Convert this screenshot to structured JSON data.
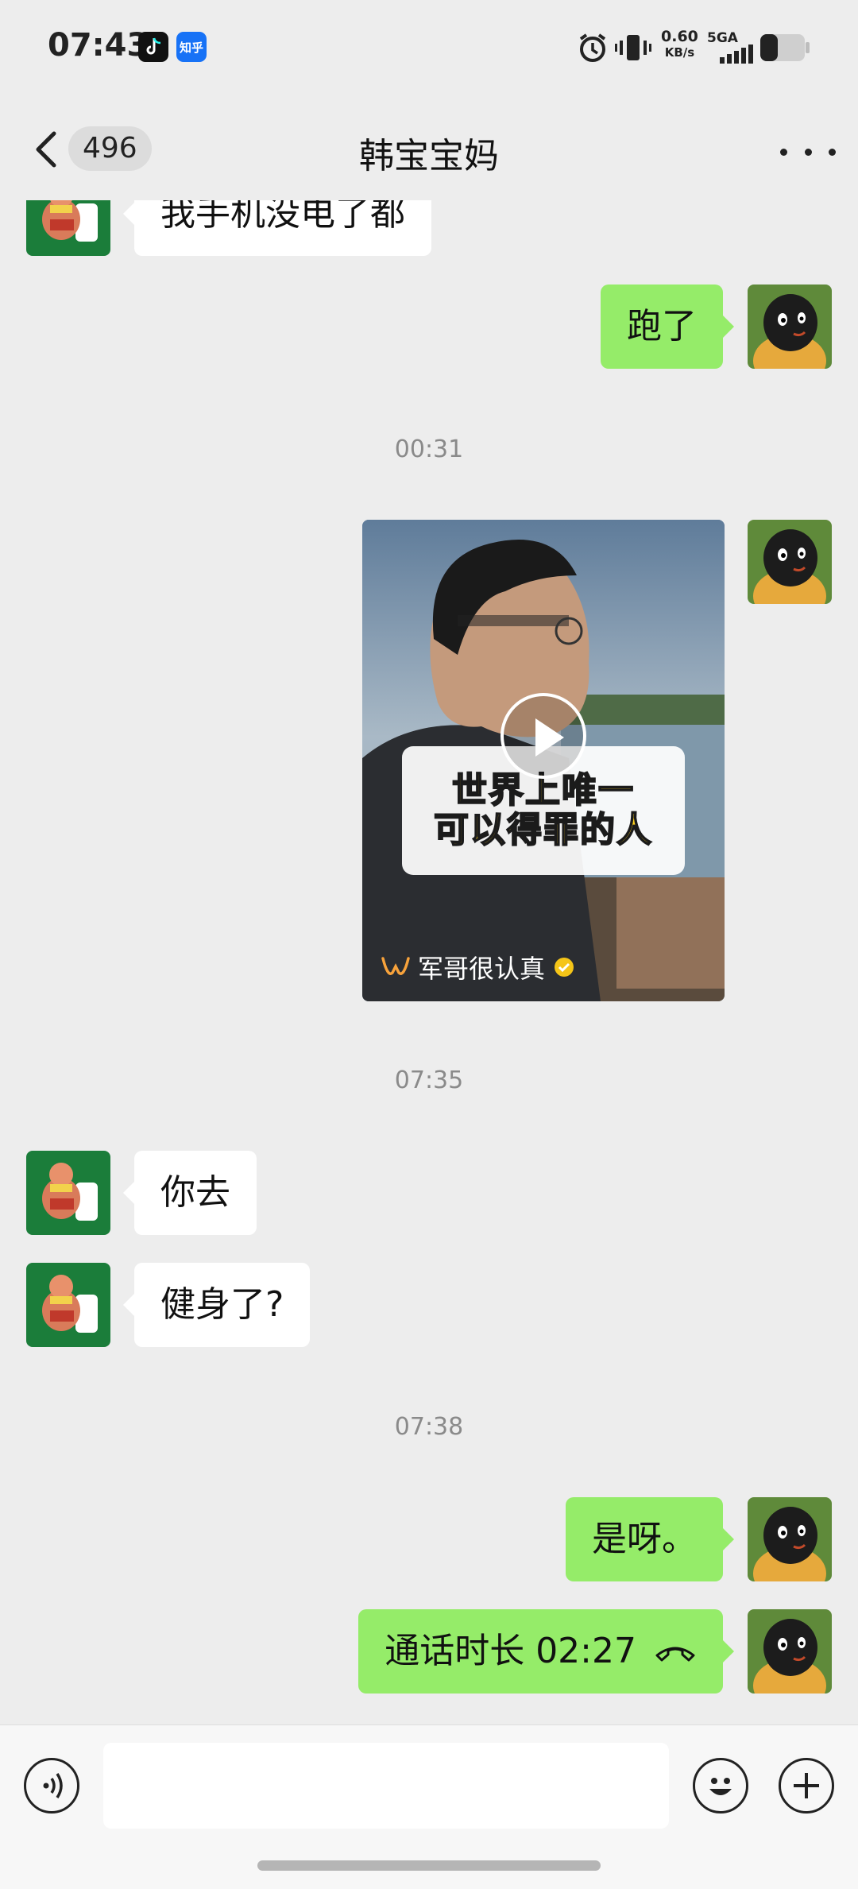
{
  "status_bar": {
    "time": "07:43",
    "app_badges": [
      "tiktok-icon",
      "知乎"
    ],
    "net_speed_value": "0.60",
    "net_speed_unit": "KB/s",
    "network_type": "5GA"
  },
  "header": {
    "unread_count": "496",
    "title": "韩宝宝妈"
  },
  "messages": [
    {
      "side": "in",
      "text": "我手机没电了都"
    },
    {
      "side": "out",
      "text": "跑了"
    },
    {
      "type": "timestamp",
      "text": "00:31"
    },
    {
      "side": "out",
      "type": "video",
      "caption_line1": "世界上唯一",
      "caption_line2": "可以得罪的人",
      "author": "军哥很认真"
    },
    {
      "type": "timestamp",
      "text": "07:35"
    },
    {
      "side": "in",
      "text": "你去"
    },
    {
      "side": "in",
      "text": "健身了?"
    },
    {
      "type": "timestamp",
      "text": "07:38"
    },
    {
      "side": "out",
      "text": "是呀。"
    },
    {
      "side": "out",
      "type": "call",
      "text": "通话时长 02:27"
    }
  ],
  "input_bar": {
    "placeholder": "",
    "icons": [
      "voice-icon",
      "emoji-icon",
      "plus-icon"
    ]
  },
  "colors": {
    "background": "#ededed",
    "outgoing_bubble": "#95ec69",
    "incoming_bubble": "#ffffff",
    "contact_avatar_bg": "#1b7d3a",
    "my_avatar_bg": "#d8a23a"
  }
}
